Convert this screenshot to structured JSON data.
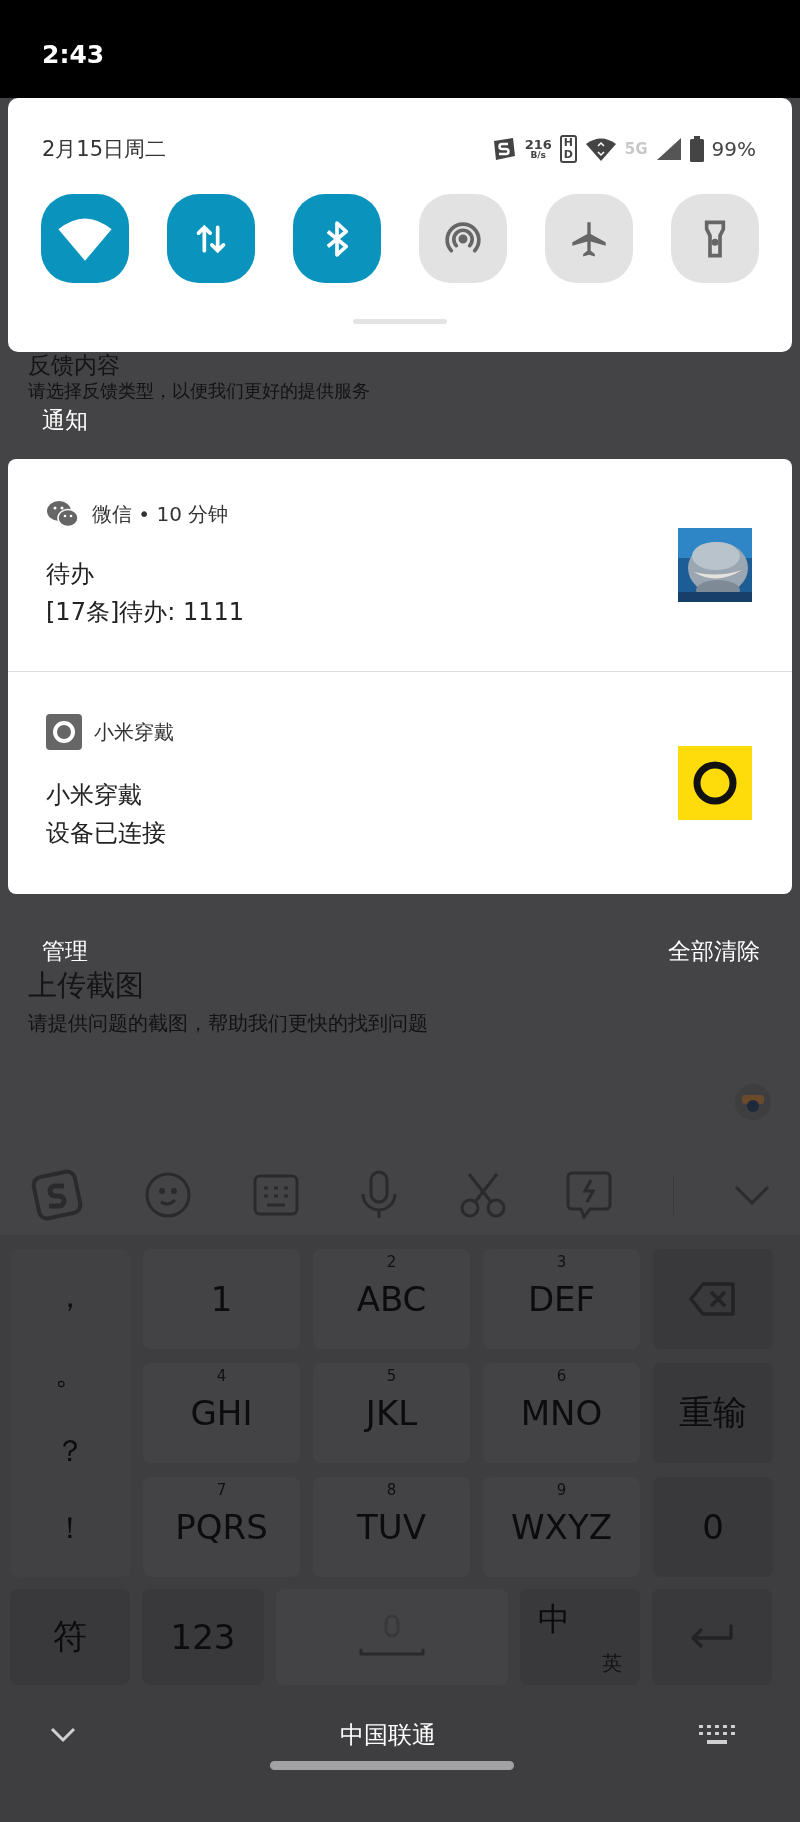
{
  "status_bar": {
    "time": "2:43"
  },
  "quick_settings": {
    "date": "2月15日周二",
    "net_speed": "216",
    "net_unit": "B/s",
    "hd": "HD",
    "network": "5G",
    "battery": "99%",
    "tiles": [
      {
        "kind": "wifi",
        "on": true
      },
      {
        "kind": "data",
        "on": true
      },
      {
        "kind": "bluetooth",
        "on": true
      },
      {
        "kind": "hotspot",
        "on": false
      },
      {
        "kind": "airplane",
        "on": false
      },
      {
        "kind": "flashlight",
        "on": false
      }
    ]
  },
  "background_form": {
    "feedback_title": "反馈内容",
    "feedback_hint": "请选择反馈类型，以便我们更好的提供服务",
    "upload_title": "上传截图",
    "upload_hint": "请提供问题的截图，帮助我们更快的找到问题"
  },
  "notifications_label": "通知",
  "notifications": [
    {
      "kind": "wechat",
      "header": "微信 • 10 分钟",
      "title": "待办",
      "body": "[17条]待办: 1111"
    },
    {
      "kind": "wear",
      "header": "小米穿戴",
      "title": "小米穿戴",
      "body": "设备已连接"
    }
  ],
  "actions": {
    "manage": "管理",
    "clear_all": "全部清除"
  },
  "keyboard": {
    "punctuation": [
      "，",
      "。",
      "？",
      "！"
    ],
    "keys": [
      {
        "kind": "text",
        "label": "1"
      },
      {
        "kind": "text",
        "digit": "2",
        "label": "ABC"
      },
      {
        "kind": "text",
        "digit": "3",
        "label": "DEF"
      },
      {
        "kind": "backspace"
      },
      {
        "kind": "text",
        "digit": "4",
        "label": "GHI"
      },
      {
        "kind": "text",
        "digit": "5",
        "label": "JKL"
      },
      {
        "kind": "text",
        "digit": "6",
        "label": "MNO"
      },
      {
        "kind": "text",
        "label": "重输"
      },
      {
        "kind": "text",
        "digit": "7",
        "label": "PQRS"
      },
      {
        "kind": "text",
        "digit": "8",
        "label": "TUV"
      },
      {
        "kind": "text",
        "digit": "9",
        "label": "WXYZ"
      },
      {
        "kind": "text",
        "label": "0"
      }
    ],
    "bottom_keys": [
      {
        "kind": "text",
        "label": "符"
      },
      {
        "kind": "text",
        "label": "123"
      },
      {
        "kind": "space"
      },
      {
        "kind": "lang",
        "label": "中",
        "sub": "英"
      },
      {
        "kind": "enter"
      }
    ]
  },
  "carrier": "中国联通"
}
